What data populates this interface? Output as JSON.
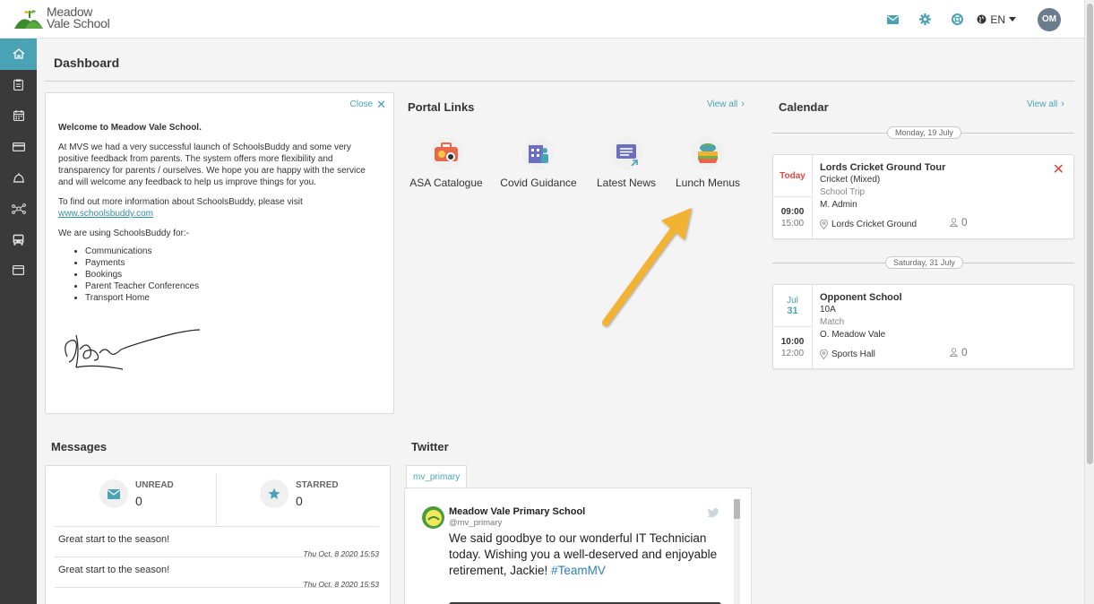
{
  "school": {
    "name_line1": "Meadow",
    "name_line2": "Vale School"
  },
  "header": {
    "language": "EN",
    "user_initials": "OM"
  },
  "page": {
    "title": "Dashboard"
  },
  "welcome": {
    "close_label": "Close",
    "heading": "Welcome to Meadow Vale School.",
    "para1": "At MVS we had a very successful launch of SchoolsBuddy and some very positive feedback from parents. The system offers more flexibility and transparency for parents / ourselves. We hope you are happy with the service and will welcome any feedback to help us improve things for you.",
    "para2_prefix": "To find out more information about SchoolsBuddy, please visit",
    "link": "www.schoolsbuddy.com",
    "para3": "We are using SchoolsBuddy for:-",
    "uses": [
      "Communications",
      "Payments",
      "Bookings",
      "Parent Teacher Conferences",
      "Transport Home"
    ]
  },
  "portal": {
    "title": "Portal Links",
    "view_all": "View all",
    "links": [
      {
        "label": "ASA Catalogue",
        "icon": "catalogue-icon"
      },
      {
        "label": "Covid Guidance",
        "icon": "covid-icon"
      },
      {
        "label": "Latest News",
        "icon": "news-icon"
      },
      {
        "label": "Lunch Menus",
        "icon": "lunch-icon"
      }
    ]
  },
  "calendar": {
    "title": "Calendar",
    "view_all": "View all",
    "days": [
      {
        "label": "Monday, 19 July",
        "event": {
          "day_badge": "Today",
          "title": "Lords Cricket Ground Tour",
          "subtitle": "Cricket (Mixed)",
          "type": "School Trip",
          "leader": "M. Admin",
          "start": "09:00",
          "end": "15:00",
          "location": "Lords Cricket Ground",
          "attendees": "0"
        }
      },
      {
        "label": "Saturday, 31 July",
        "event": {
          "month": "Jul",
          "day": "31",
          "title": "Opponent School",
          "subtitle": "10A",
          "type": "Match",
          "leader": "O. Meadow Vale",
          "start": "10:00",
          "end": "12:00",
          "location": "Sports Hall",
          "attendees": "0"
        }
      }
    ]
  },
  "messages": {
    "title": "Messages",
    "unread_label": "UNREAD",
    "unread_count": "0",
    "starred_label": "STARRED",
    "starred_count": "0",
    "items": [
      {
        "text": "Great start to the season!",
        "date": "Thu Oct, 8 2020 15:53"
      },
      {
        "text": "Great start to the season!",
        "date": "Thu Oct, 8 2020 15:53"
      }
    ]
  },
  "twitter": {
    "title": "Twitter",
    "tab": "mv_primary",
    "tweet": {
      "name": "Meadow Vale Primary School",
      "handle": "@mv_primary",
      "text": "We said goodbye to our wonderful IT Technician today. Wishing you a well-deserved and enjoyable retirement, Jackie!",
      "hashtag": "#TeamMV"
    }
  },
  "colors": {
    "accent": "#4aa3b5",
    "sidebar": "#3a3a3a",
    "danger": "#e04848",
    "arrow": "#f2b330"
  }
}
